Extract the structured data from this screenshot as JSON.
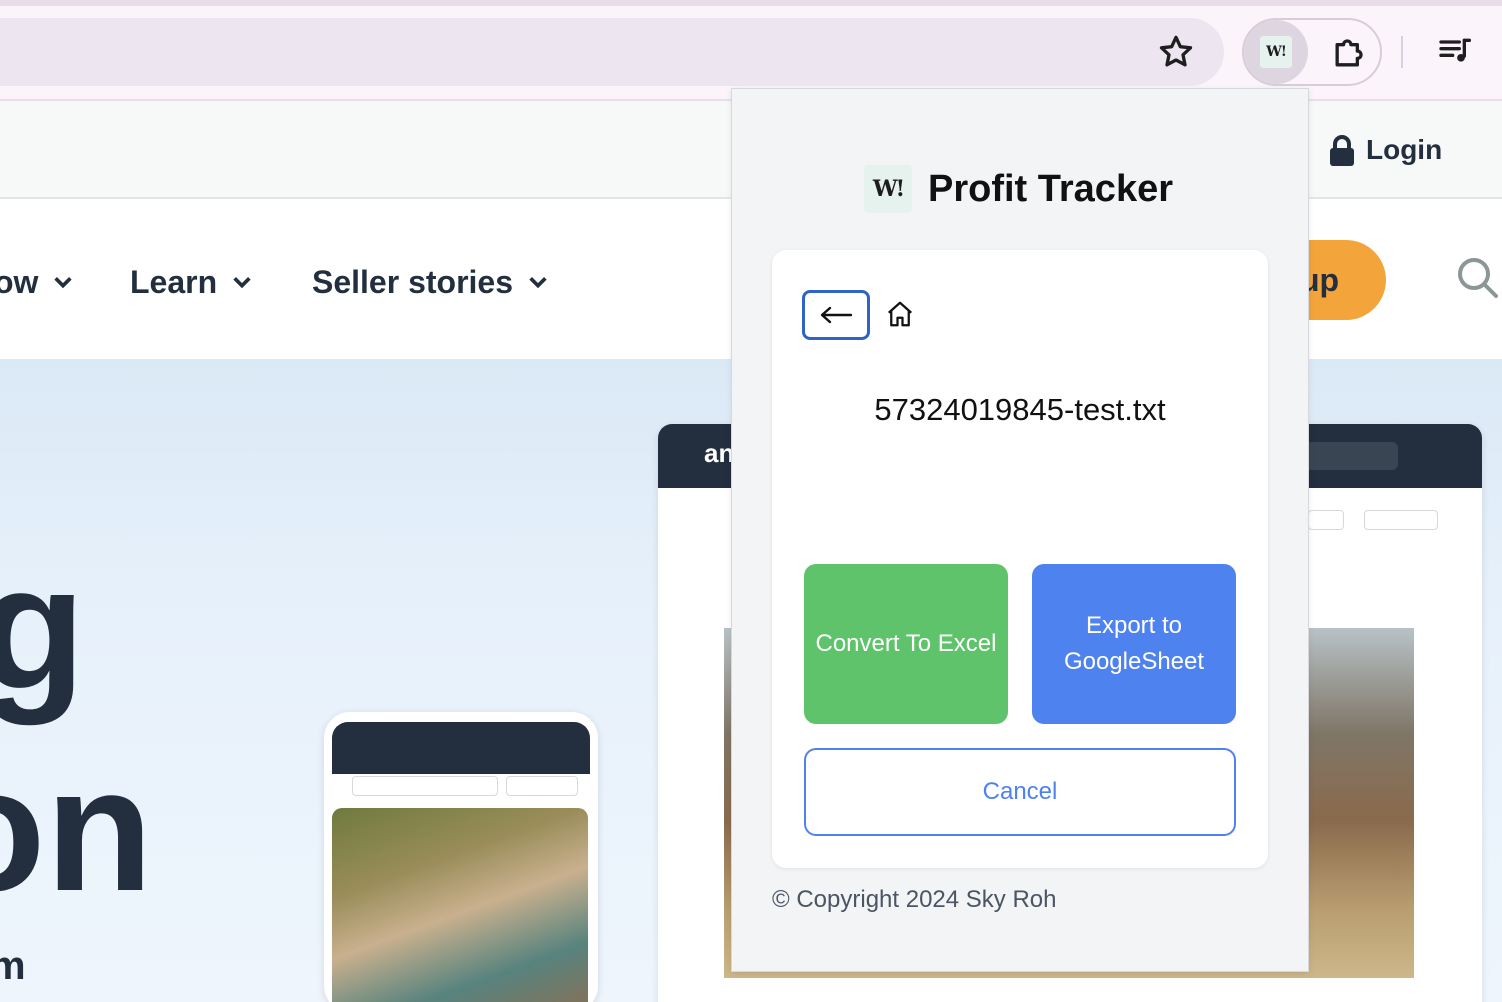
{
  "browser": {
    "extension_icon_text": "W!"
  },
  "site": {
    "login_label": "Login",
    "nav_items": [
      {
        "label": "ow"
      },
      {
        "label": "Learn"
      },
      {
        "label": "Seller stories"
      }
    ],
    "signup_partial": "up",
    "hero_partial_lines": [
      "g",
      "on",
      "m"
    ],
    "mockup_logo_partial": "an"
  },
  "popup": {
    "logo_text": "W!",
    "title": "Profit Tracker",
    "file_name": "57324019845-test.txt",
    "convert_button": "Convert To Excel",
    "export_button": "Export to GoogleSheet",
    "cancel_button": "Cancel",
    "copyright": "© Copyright 2024 Sky Roh",
    "colors": {
      "convert": "#5ec36a",
      "export": "#4e82ee",
      "back_border": "#2f64c6"
    }
  },
  "icons": [
    "star-icon",
    "puzzle-icon",
    "media-queue-icon",
    "lock-icon",
    "chevron-down-icon",
    "search-icon",
    "back-arrow-icon",
    "home-icon"
  ]
}
